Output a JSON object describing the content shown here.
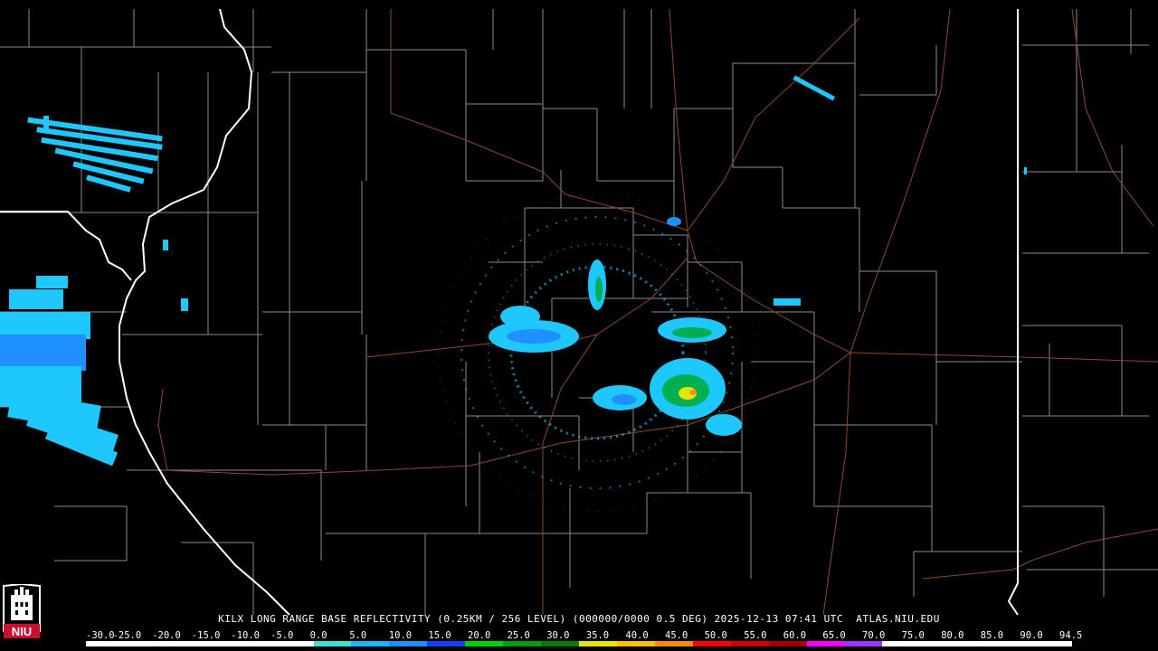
{
  "caption": "KILX LONG RANGE BASE REFLECTIVITY (0.25KM / 256 LEVEL) (000000/0000 0.5 DEG) 2025-12-13 07:41 UTC  ATLAS.NIU.EDU",
  "logo_text": "NIU",
  "scale_labels": [
    "-30.0",
    "-25.0",
    "-20.0",
    "-15.0",
    "-10.0",
    "-5.0",
    "0.0",
    "5.0",
    "10.0",
    "15.0",
    "20.0",
    "25.0",
    "30.0",
    "35.0",
    "40.0",
    "45.0",
    "50.0",
    "55.0",
    "60.0",
    "65.0",
    "70.0",
    "75.0",
    "80.0",
    "85.0",
    "90.0",
    "94.5"
  ],
  "scale_colors": [
    "#ffffff",
    "#ffffff",
    "#ffffff",
    "#ffffff",
    "#ffffff",
    "#ffffff",
    "#40e0d0",
    "#1fb5ff",
    "#1e90ff",
    "#1040ff",
    "#00d000",
    "#00a000",
    "#007a00",
    "#e6e600",
    "#ffc000",
    "#ff8c00",
    "#ff0000",
    "#d00000",
    "#a00000",
    "#ff00ff",
    "#9933ff",
    "#ffffff",
    "#ffffff",
    "#ffffff",
    "#ffffff",
    "#ffffff"
  ],
  "colors": {
    "background": "#000000",
    "county_lines": "#8c8c8c",
    "state_lines": "#ffffff",
    "highways": "#8b4a2b"
  }
}
